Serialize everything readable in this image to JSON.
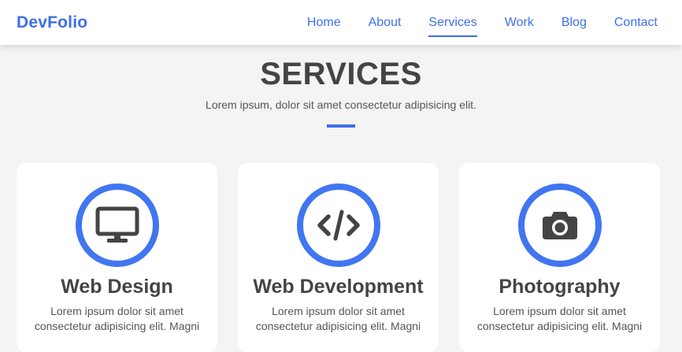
{
  "header": {
    "brand": "DevFolio",
    "nav": [
      "Home",
      "About",
      "Services",
      "Work",
      "Blog",
      "Contact"
    ],
    "active_index": 2
  },
  "section": {
    "title": "SERVICES",
    "subtitle": "Lorem ipsum, dolor sit amet consectetur adipisicing elit."
  },
  "services": [
    {
      "icon": "desktop-icon",
      "title": "Web Design",
      "text": "Lorem ipsum dolor sit amet consectetur adipisicing elit. Magni"
    },
    {
      "icon": "code-icon",
      "title": "Web Development",
      "text": "Lorem ipsum dolor sit amet consectetur adipisicing elit. Magni"
    },
    {
      "icon": "camera-icon",
      "title": "Photography",
      "text": "Lorem ipsum dolor sit amet consectetur adipisicing elit. Magni"
    }
  ],
  "colors": {
    "accent": "#3f6fe8",
    "ring": "#4176f0",
    "background": "#f4f4f4",
    "card": "#ffffff",
    "text": "#444444"
  }
}
